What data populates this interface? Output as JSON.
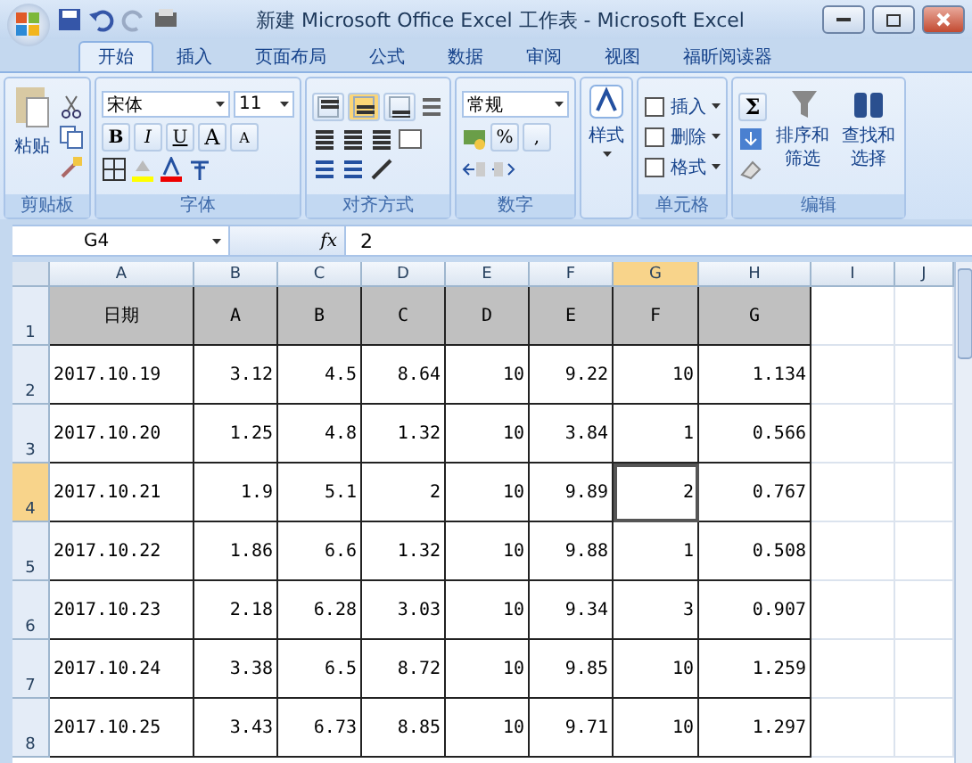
{
  "window": {
    "title": "新建 Microsoft Office Excel 工作表 - Microsoft Excel"
  },
  "tabs": [
    {
      "label": "开始",
      "selected": true
    },
    {
      "label": "插入",
      "selected": false
    },
    {
      "label": "页面布局",
      "selected": false
    },
    {
      "label": "公式",
      "selected": false
    },
    {
      "label": "数据",
      "selected": false
    },
    {
      "label": "审阅",
      "selected": false
    },
    {
      "label": "视图",
      "selected": false
    },
    {
      "label": "福昕阅读器",
      "selected": false
    }
  ],
  "ribbon": {
    "clipboard": {
      "paste": "粘贴",
      "label": "剪贴板"
    },
    "font": {
      "name": "宋体",
      "size": "11",
      "bold": "B",
      "italic": "I",
      "underline": "U",
      "grow": "A",
      "shrink": "A",
      "label": "字体"
    },
    "alignment": {
      "vertical": [
        {
          "selected": false
        },
        {
          "selected": true
        },
        {
          "selected": false
        }
      ],
      "label": "对齐方式"
    },
    "number": {
      "format": "常规",
      "percent": "%",
      "comma": ",",
      "label": "数字"
    },
    "styles": {
      "button": "样式"
    },
    "cells": {
      "items": [
        "插入",
        "删除",
        "格式"
      ],
      "label": "单元格"
    },
    "editing": {
      "sum": "Σ",
      "sort": "排序和筛选",
      "find": "查找和选择",
      "label": "编辑"
    }
  },
  "formula_bar": {
    "name_box": "G4",
    "fx": "fx",
    "value": "2"
  },
  "sheet": {
    "columns": [
      {
        "label": "A",
        "selected": false
      },
      {
        "label": "B",
        "selected": false
      },
      {
        "label": "C",
        "selected": false
      },
      {
        "label": "D",
        "selected": false
      },
      {
        "label": "E",
        "selected": false
      },
      {
        "label": "F",
        "selected": false
      },
      {
        "label": "G",
        "selected": true
      },
      {
        "label": "H",
        "selected": false
      },
      {
        "label": "I",
        "selected": false
      },
      {
        "label": "J",
        "selected": false
      }
    ],
    "rows": [
      {
        "number": "1",
        "kind": "header",
        "selected": false,
        "cells": [
          "日期",
          "A",
          "B",
          "C",
          "D",
          "E",
          "F",
          "G"
        ]
      },
      {
        "number": "2",
        "kind": "data",
        "selected": false,
        "cells": [
          "2017.10.19",
          "3.12",
          "4.5",
          "8.64",
          "10",
          "9.22",
          "10",
          "1.134"
        ]
      },
      {
        "number": "3",
        "kind": "data",
        "selected": false,
        "cells": [
          "2017.10.20",
          "1.25",
          "4.8",
          "1.32",
          "10",
          "3.84",
          "1",
          "0.566"
        ]
      },
      {
        "number": "4",
        "kind": "data",
        "selected": true,
        "cells": [
          "2017.10.21",
          "1.9",
          "5.1",
          "2",
          "10",
          "9.89",
          "2",
          "0.767"
        ]
      },
      {
        "number": "5",
        "kind": "data",
        "selected": false,
        "cells": [
          "2017.10.22",
          "1.86",
          "6.6",
          "1.32",
          "10",
          "9.88",
          "1",
          "0.508"
        ]
      },
      {
        "number": "6",
        "kind": "data",
        "selected": false,
        "cells": [
          "2017.10.23",
          "2.18",
          "6.28",
          "3.03",
          "10",
          "9.34",
          "3",
          "0.907"
        ]
      },
      {
        "number": "7",
        "kind": "data",
        "selected": false,
        "cells": [
          "2017.10.24",
          "3.38",
          "6.5",
          "8.72",
          "10",
          "9.85",
          "10",
          "1.259"
        ]
      },
      {
        "number": "8",
        "kind": "data",
        "selected": false,
        "cells": [
          "2017.10.25",
          "3.43",
          "6.73",
          "8.85",
          "10",
          "9.71",
          "10",
          "1.297"
        ]
      }
    ]
  }
}
